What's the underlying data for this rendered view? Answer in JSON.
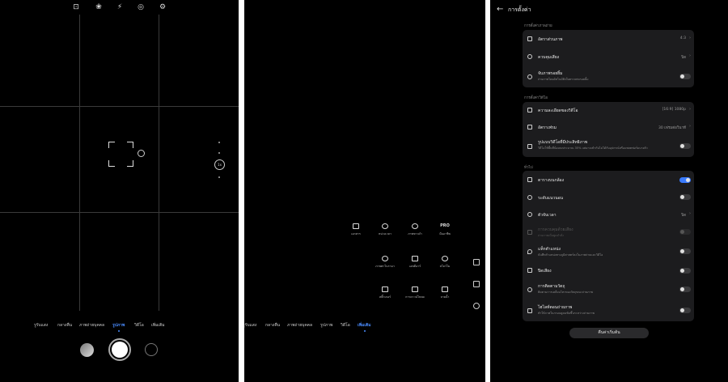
{
  "camera": {
    "modes": [
      "รูรับแสง",
      "กลางคืน",
      "ภาพถ่ายบุคคล",
      "รูปภาพ",
      "วิดีโอ",
      "เพิ่มเติม"
    ],
    "zoom_label": "1x"
  },
  "more": {
    "tiles": [
      {
        "icon": "document-icon",
        "label": "เอกสาร"
      },
      {
        "icon": "timelapse-icon",
        "label": "หน่วงเวลา"
      },
      {
        "icon": "aperture-icon",
        "label": "ภาพขาวดำ"
      },
      {
        "icon": "pro-icon",
        "label": "มืออาชีพ",
        "text": "PRO"
      },
      {
        "icon": "panorama-icon",
        "label": "ภาพพาโนรามา"
      },
      {
        "icon": "hdr-icon",
        "label": "เอชดีอาร์"
      },
      {
        "icon": "slowmo-icon",
        "label": "สโลว์โม"
      },
      {
        "icon": "sticker-icon",
        "label": "สติ๊กเกอร์"
      },
      {
        "icon": "download-icon",
        "label": "การดาวน์โหลด"
      },
      {
        "icon": "watermark-icon",
        "label": "ลายน้ำ"
      }
    ]
  },
  "settings": {
    "title": "การตั้งค่า",
    "photo_section": "การตั้งค่าภาพถ่าย",
    "aspect_ratio": {
      "title": "อัตราส่วนภาพ",
      "value": "4:3"
    },
    "sound_control": {
      "title": "ควบคุมเสียง",
      "value": "ปิด"
    },
    "smile_capture": {
      "title": "จับภาพรอยยิ้ม",
      "sub": "ถ่ายภาพโดยอัตโนมัติเมื่อตรวจพบรอยยิ้ม"
    },
    "video_section": "การตั้งค่าวิดีโอ",
    "video_resolution": {
      "title": "ความละเอียดของวิดีโอ",
      "value": "[16:9] 1080p"
    },
    "frame_rate": {
      "title": "อัตราเฟรม",
      "value": "30 เฟรมต่อวินาที"
    },
    "efficient_video": {
      "title": "รูปแบบวิดีโอที่มีประสิทธิภาพ",
      "sub": "วิดีโอใช้พื้นที่น้อยลงประมาณ 35% แต่อาจเข้ากันไม่ได้กับอุปกรณ์หรือแพลตฟอร์มบางตัว"
    },
    "general_section": "ทั่วไป",
    "grid": {
      "title": "ตารางบนกล้อง"
    },
    "level": {
      "title": "ระดับแนวนอน"
    },
    "timer": {
      "title": "ตัวจับเวลา",
      "value": "ปิด"
    },
    "audio_control": {
      "title": "การควบคุมด้วยเสียง",
      "sub": "ถ่ายภาพเมื่อพูดคำสั่ง"
    },
    "location_tag": {
      "title": "แท็กตำแหน่ง",
      "sub": "บันทึกตำแหน่งทางภูมิศาสตร์ลงในภาพถ่ายและวิดีโอ"
    },
    "mute": {
      "title": "ปิดเสียง"
    },
    "stabilization": {
      "title": "การติดตามวัตถุ",
      "sub": "ติดตามการเคลื่อนไหวของวัตถุขณะถ่ายภาพ"
    },
    "mirror": {
      "title": "ไฮไลท์ตอนถ่ายภาพ",
      "sub": "ทำให้ภาพในกรอบดูคมชัดขึ้นระหว่างถ่ายภาพ"
    },
    "reset_label": "คืนค่าเริ่มต้น"
  }
}
